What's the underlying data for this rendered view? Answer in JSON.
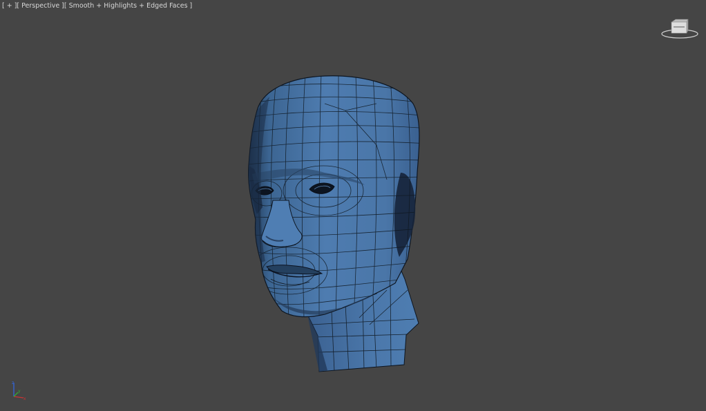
{
  "viewport": {
    "menu_plus": "[ + ]",
    "menu_view": "[ Perspective ]",
    "menu_shading": "[ Smooth + Highlights + Edged Faces ]",
    "background_color": "#454545"
  },
  "model": {
    "mesh_color": "#4a76a8",
    "shadow_color": "#2a4a6e",
    "wire_color": "#101820"
  },
  "viewcube": {
    "icon": "viewcube-icon"
  },
  "axis_tripod": {
    "icon": "axis-tripod-icon",
    "x_color": "#cc3333",
    "y_color": "#33aa33",
    "z_color": "#3366dd"
  }
}
